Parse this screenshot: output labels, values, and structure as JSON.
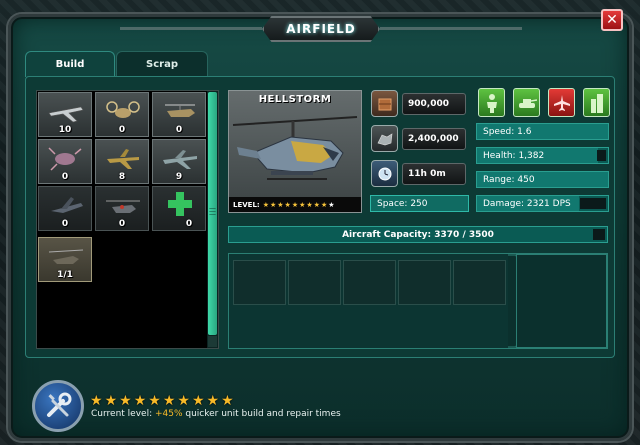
{
  "window": {
    "title": "AIRFIELD",
    "close_label": "✕"
  },
  "tabs": [
    {
      "label": "Build",
      "active": true
    },
    {
      "label": "Scrap",
      "active": false
    }
  ],
  "unit_grid": [
    {
      "name": "aircraft-1",
      "count": "10"
    },
    {
      "name": "aircraft-2",
      "count": "0"
    },
    {
      "name": "aircraft-3",
      "count": "0"
    },
    {
      "name": "aircraft-4",
      "count": "0"
    },
    {
      "name": "aircraft-5",
      "count": "8"
    },
    {
      "name": "aircraft-6",
      "count": "9"
    },
    {
      "name": "aircraft-7",
      "count": "0"
    },
    {
      "name": "aircraft-8",
      "count": "0"
    },
    {
      "name": "add-slot",
      "count": "0"
    },
    {
      "name": "hellstorm",
      "count": "1/1"
    }
  ],
  "selected_unit": {
    "name": "HELLSTORM",
    "level_label": "LEVEL:",
    "level_stars_filled": 9,
    "level_stars_total": 10
  },
  "costs": {
    "resource_1": "900,000",
    "resource_2": "2,400,000",
    "build_time": "11h 0m",
    "space": "Space: 250"
  },
  "unit_type_icons": [
    "infantry-icon",
    "tank-icon",
    "aircraft-icon",
    "building-icon"
  ],
  "stats": {
    "speed": "Speed: 1.6",
    "health": "Health: 1,382",
    "range": "Range: 450",
    "damage": "Damage: 2321 DPS"
  },
  "capacity": {
    "label": "Aircraft Capacity: 3370 / 3500",
    "current": 3370,
    "max": 3500
  },
  "queue": {
    "slots": 5
  },
  "footer": {
    "stars": 10,
    "text_prefix": "Current level: ",
    "bonus": "+45%",
    "text_suffix": " quicker unit build and repair times"
  },
  "colors": {
    "panel": "#0d3a35",
    "accent": "#2fb9a8",
    "star": "#f7b928",
    "close": "#e4393a"
  }
}
